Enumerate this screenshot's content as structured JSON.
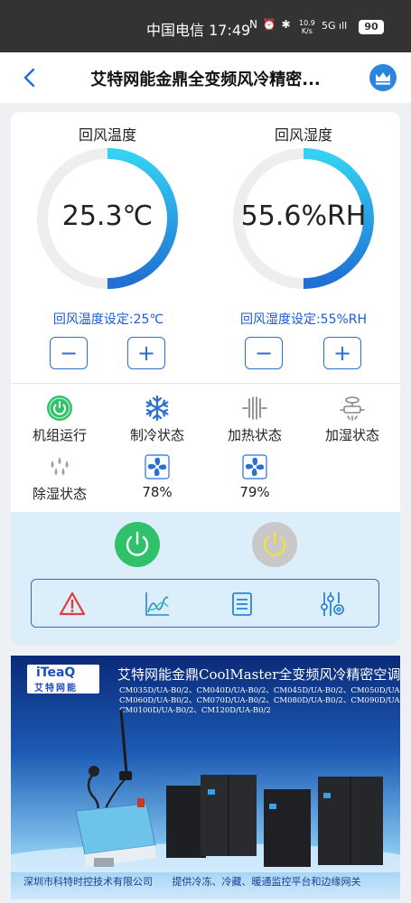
{
  "status_bar": {
    "carrier": "中国电信",
    "time": "17:49",
    "icons_text": "N ⏰ ✱",
    "net_speed": "10.9",
    "net_unit": "K/s",
    "signal_text": "5G ıll",
    "battery": "90"
  },
  "header": {
    "title": "艾特网能金鼎全变频风冷精密..."
  },
  "gauges": [
    {
      "title": "回风温度",
      "value": "25.3℃",
      "setpoint": "回风温度设定:25℃",
      "minus": "−",
      "plus": "+"
    },
    {
      "title": "回风湿度",
      "value": "55.6%RH",
      "setpoint": "回风湿度设定:55%RH",
      "minus": "−",
      "plus": "+"
    }
  ],
  "status_items": [
    {
      "label": "机组运行",
      "icon": "power-on-icon"
    },
    {
      "label": "制冷状态",
      "icon": "snowflake-icon"
    },
    {
      "label": "加热状态",
      "icon": "heater-icon"
    },
    {
      "label": "加湿状态",
      "icon": "humidifier-icon"
    },
    {
      "label": "除湿状态",
      "icon": "dehumidify-icon"
    },
    {
      "label": "78%",
      "icon": "fan-icon"
    },
    {
      "label": "79%",
      "icon": "fan-icon"
    }
  ],
  "controls": {
    "power_on_color": "#2fc26a",
    "power_off_color": "#c8c8c8",
    "tools": [
      "alarm-icon",
      "chart-icon",
      "list-icon",
      "settings-sliders-icon"
    ]
  },
  "banner": {
    "logo_main": "iTeaQ",
    "logo_sub": "艾特网能",
    "heading": "艾特网能金鼎CoolMaster全变频风冷精密空调",
    "models": [
      "CM035D/UA-B0/2、CM040D/UA-B0/2、CM045D/UA-B0/2、CM050D/UA-B0/2",
      "CM060D/UA-B0/2、CM070D/UA-B0/2、CM080D/UA-B0/2、CM090D/UA-B0/2",
      "CM0100D/UA-B0/2、CM120D/UA-B0/2"
    ],
    "footer_left": "深圳市科特时控技术有限公司",
    "footer_right": "提供冷冻、冷藏、暖通监控平台和边缘网关"
  },
  "colors": {
    "accent": "#2a6fd6",
    "gauge_track": "#eeeeee",
    "gauge_start": "#1f6fd4",
    "gauge_end": "#34d2f2"
  },
  "levels": {
    "temperature_arc_fraction": 0.5,
    "humidity_arc_fraction": 0.5
  }
}
